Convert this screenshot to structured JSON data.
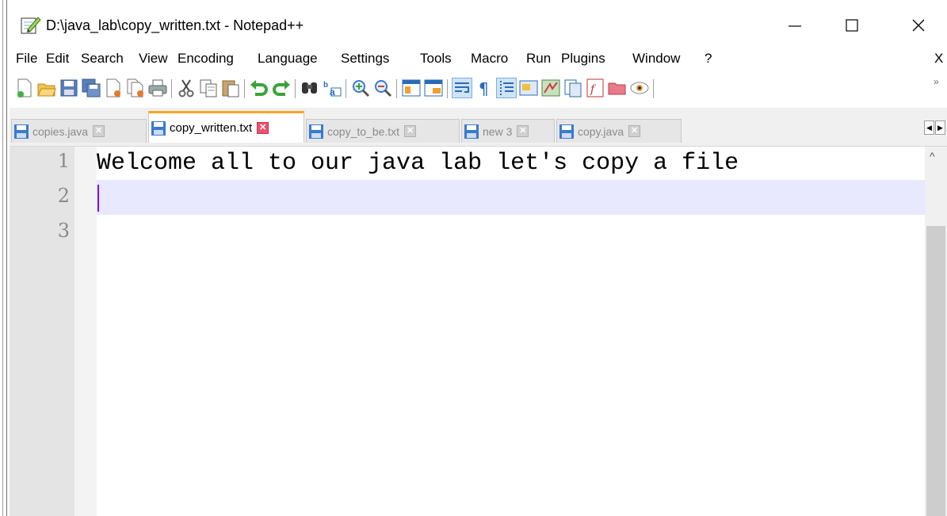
{
  "window": {
    "title": "D:\\java_lab\\copy_written.txt - Notepad++",
    "controls": {
      "minimize": "—",
      "maximize": "☐",
      "close": "✕"
    }
  },
  "menu": {
    "items": [
      "File",
      "Edit",
      "Search",
      "View",
      "Encoding",
      "Language",
      "Settings",
      "Tools",
      "Macro",
      "Run",
      "Plugins",
      "Window",
      "?"
    ],
    "close_label": "X"
  },
  "toolbar": {
    "icons": [
      "new-file-icon",
      "open-file-icon",
      "save-icon",
      "save-all-icon",
      "close-icon",
      "close-all-icon",
      "print-icon",
      "cut-icon",
      "copy-icon",
      "paste-icon",
      "undo-icon",
      "redo-icon",
      "find-icon",
      "replace-icon",
      "zoom-in-icon",
      "zoom-out-icon",
      "sync-vertical-icon",
      "sync-horizontal-icon",
      "word-wrap-icon",
      "show-all-chars-icon",
      "indent-guide-icon",
      "doc-map-icon",
      "function-list-icon",
      "folder-as-workspace-icon",
      "pdf-icon",
      "folder-icon",
      "monitor-icon"
    ],
    "overflow_label": "»"
  },
  "tabs": [
    {
      "label": "copies.java",
      "active": false
    },
    {
      "label": "copy_written.txt",
      "active": true
    },
    {
      "label": "copy_to_be.txt",
      "active": false
    },
    {
      "label": "new 3",
      "active": false
    },
    {
      "label": "copy.java",
      "active": false
    }
  ],
  "editor": {
    "lines": [
      {
        "num": "1",
        "text": "Welcome all to our java lab let's copy a file"
      },
      {
        "num": "2",
        "text": ""
      },
      {
        "num": "3",
        "text": ""
      }
    ],
    "current_line": 2
  },
  "colors": {
    "active_tab_accent": "#f5a623",
    "current_line_bg": "#e8e8ff",
    "caret": "#8000ff",
    "tab_close_active": "#e8546f"
  }
}
